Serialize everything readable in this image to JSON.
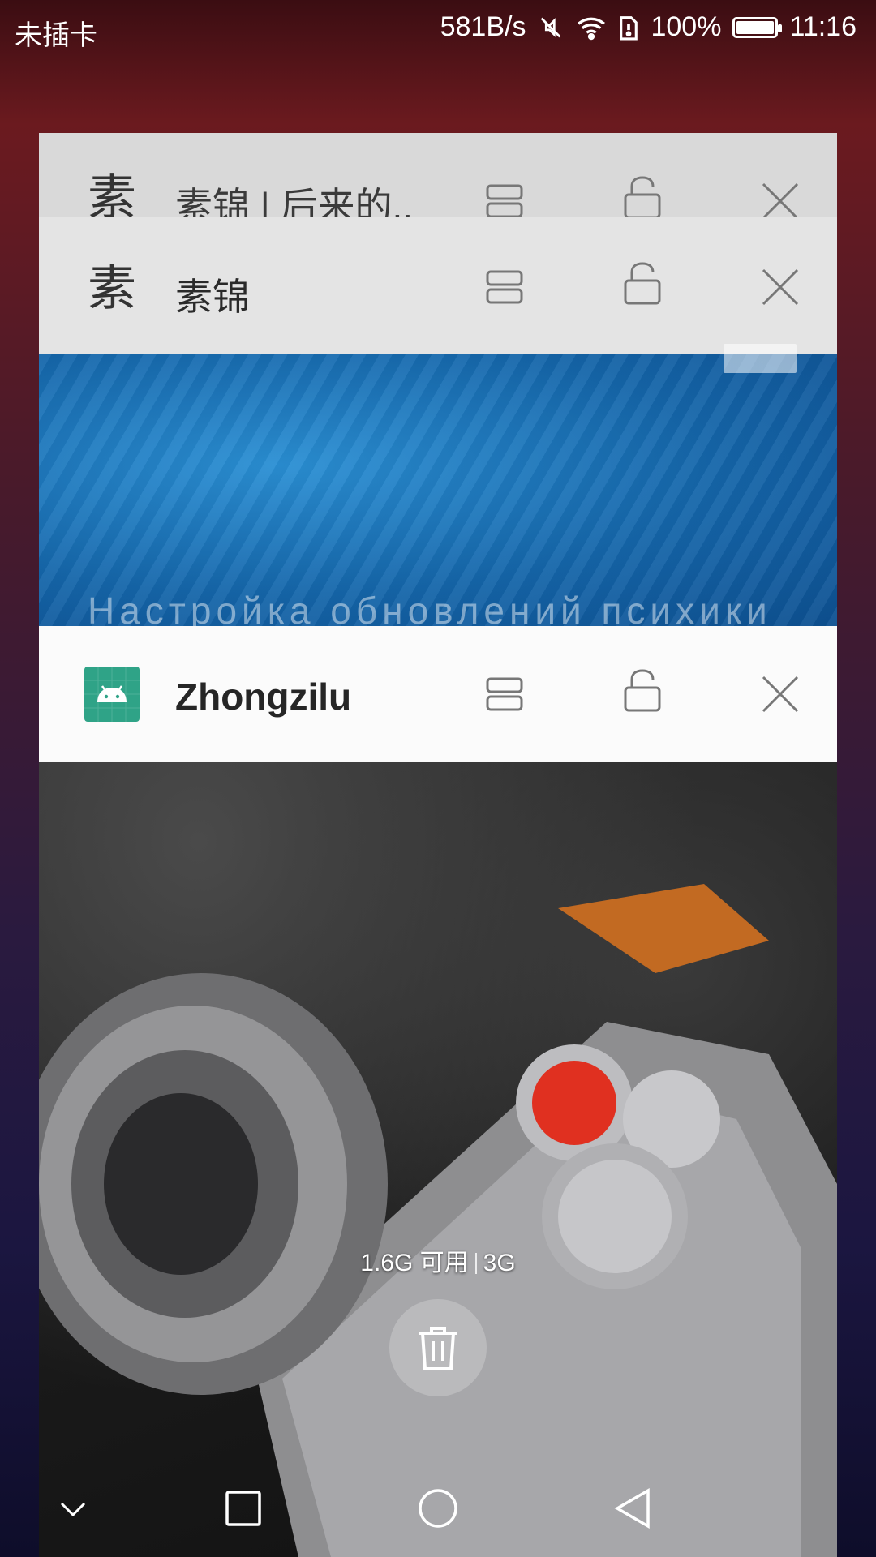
{
  "status_bar": {
    "carrier": "未插卡",
    "net_speed": "581B/s",
    "battery": "100%",
    "battery_level": 1.0,
    "time": "11:16",
    "icons": [
      "mute-icon",
      "wifi-icon",
      "alert-sim-icon",
      "battery-icon"
    ]
  },
  "cards": [
    {
      "icon_text": "素",
      "title": "素锦 | 后来的.."
    },
    {
      "icon_text": "素",
      "title": "素锦",
      "content_text": "Настройка обновлений психики"
    },
    {
      "icon": "android-icon",
      "title": "Zhongzilu",
      "icon_color": "#2fa387"
    }
  ],
  "memory": {
    "available": "1.6G 可用",
    "total": "3G"
  },
  "nav": [
    "collapse-icon",
    "recents-icon",
    "home-icon",
    "back-icon"
  ],
  "colors": {
    "accent_green": "#2fa387",
    "header_gray": "#e4e4e4",
    "header_white": "#fbfbfb"
  }
}
